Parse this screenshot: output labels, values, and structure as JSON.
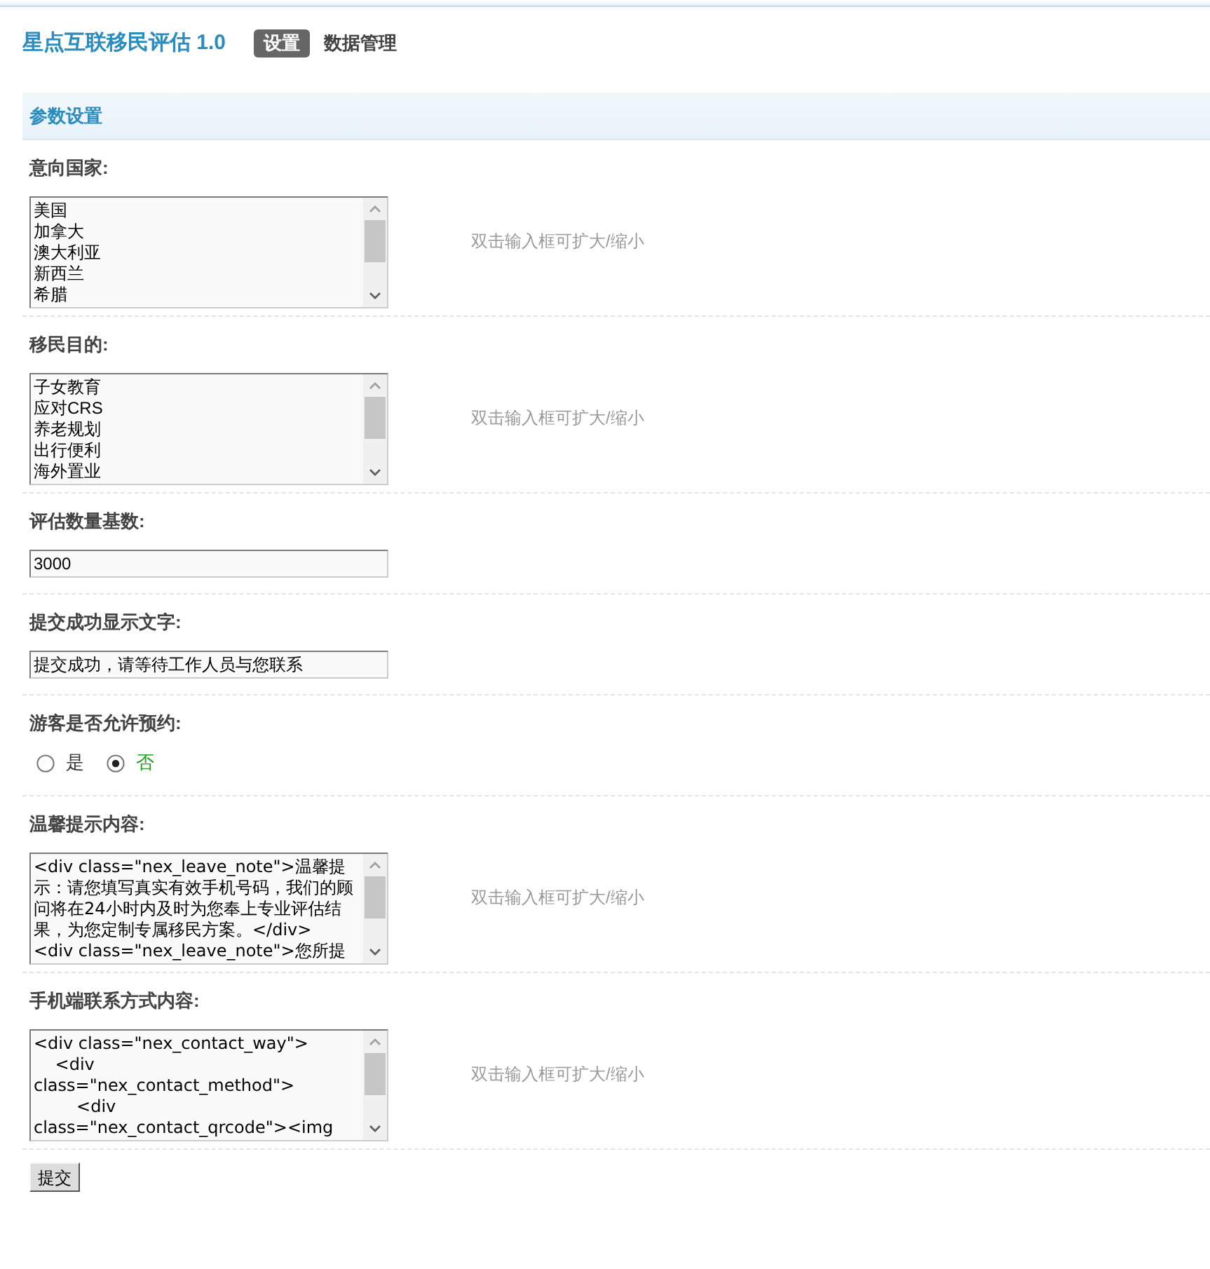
{
  "header": {
    "title": "星点互联移民评估 1.0",
    "tabs": [
      {
        "label": "设置",
        "selected": true
      },
      {
        "label": "数据管理",
        "selected": false
      }
    ]
  },
  "section": {
    "title": "参数设置"
  },
  "settings": [
    {
      "kind": "list",
      "label": "意向国家:",
      "items": [
        "美国",
        "加拿大",
        "澳大利亚",
        "新西兰",
        "希腊"
      ],
      "hint": "双击输入框可扩大/缩小"
    },
    {
      "kind": "list",
      "label": "移民目的:",
      "items": [
        "子女教育",
        "应对CRS",
        "养老规划",
        "出行便利",
        "海外置业"
      ],
      "hint": "双击输入框可扩大/缩小"
    },
    {
      "kind": "input",
      "label": "评估数量基数:",
      "value": "3000"
    },
    {
      "kind": "input",
      "label": "提交成功显示文字:",
      "value": "提交成功，请等待工作人员与您联系"
    },
    {
      "kind": "radio",
      "label": "游客是否允许预约:",
      "options": [
        {
          "label": "是",
          "selected": false
        },
        {
          "label": "否",
          "selected": true
        }
      ]
    },
    {
      "kind": "textarea",
      "label": "温馨提示内容:",
      "value": "<div class=\"nex_leave_note\">温馨提示：请您填写真实有效手机号码，我们的顾问将在24小时内及时为您奉上专业评估结果，为您定制专属移民方案。</div>\n<div class=\"nex_leave_note\">您所提",
      "hint": "双击输入框可扩大/缩小"
    },
    {
      "kind": "textarea",
      "label": "手机端联系方式内容:",
      "value": "<div class=\"nex_contact_way\">\n    <div class=\"nex_contact_method\">\n        <div class=\"nex_contact_qrcode\"><img",
      "hint": "双击输入框可扩大/缩小"
    }
  ],
  "submit_button": "提交"
}
